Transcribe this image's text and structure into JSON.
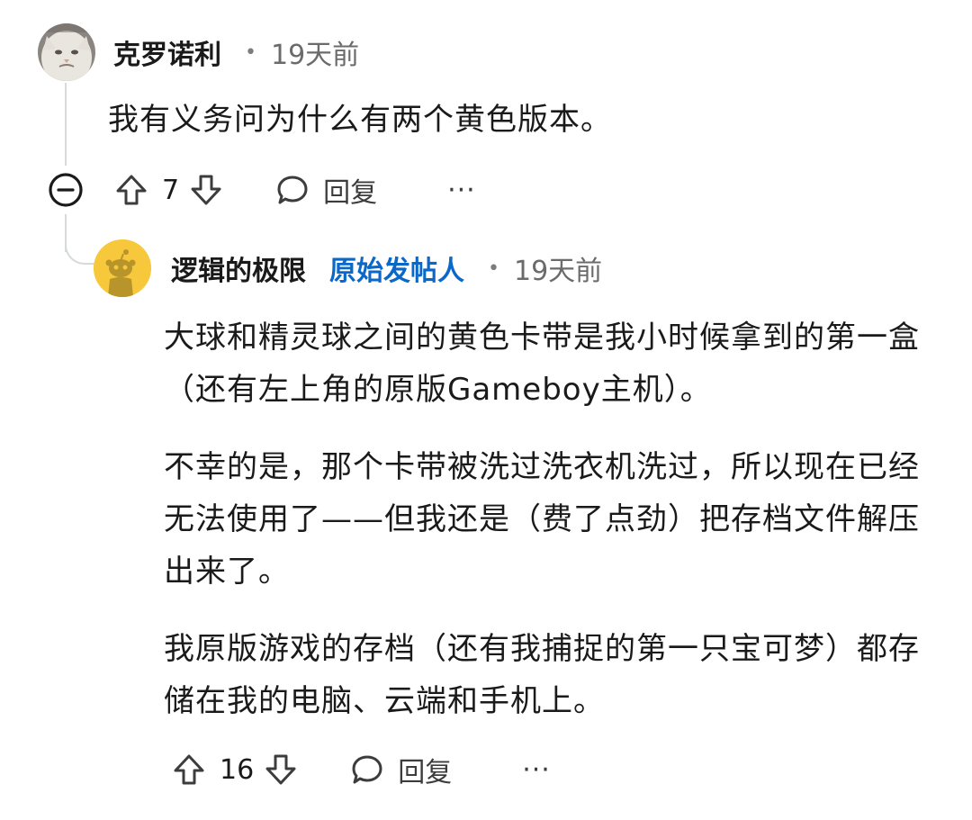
{
  "parent_comment": {
    "username": "克罗诺利",
    "separator": "•",
    "time": "19天前",
    "body": "我有义务问为什么有两个黄色版本。",
    "votes": "7",
    "reply_label": "回复",
    "more_label": "···"
  },
  "reply_comment": {
    "username": "逻辑的极限",
    "op_badge": "原始发帖人",
    "separator": "•",
    "time": "19天前",
    "paragraphs": [
      "大球和精灵球之间的黄色卡带是我小时候拿到的第一盒（还有左上角的原版Gameboy主机）。",
      "不幸的是，那个卡带被洗过洗衣机洗过，所以现在已经无法使用了——但我还是（费了点劲）把存档文件解压出来了。",
      "我原版游戏的存档（还有我捕捉的第一只宝可梦）都存储在我的电脑、云端和手机上。"
    ],
    "votes": "16",
    "reply_label": "回复",
    "more_label": "···"
  },
  "colors": {
    "op_badge": "#0a68c8",
    "thread_line": "#d7dadc",
    "snoo_avatar_bg": "#f7c83b"
  },
  "icons": {
    "upvote": "arrow-up-outline-icon",
    "downvote": "arrow-down-outline-icon",
    "reply": "speech-bubble-icon",
    "collapse": "minus-circle-icon"
  }
}
